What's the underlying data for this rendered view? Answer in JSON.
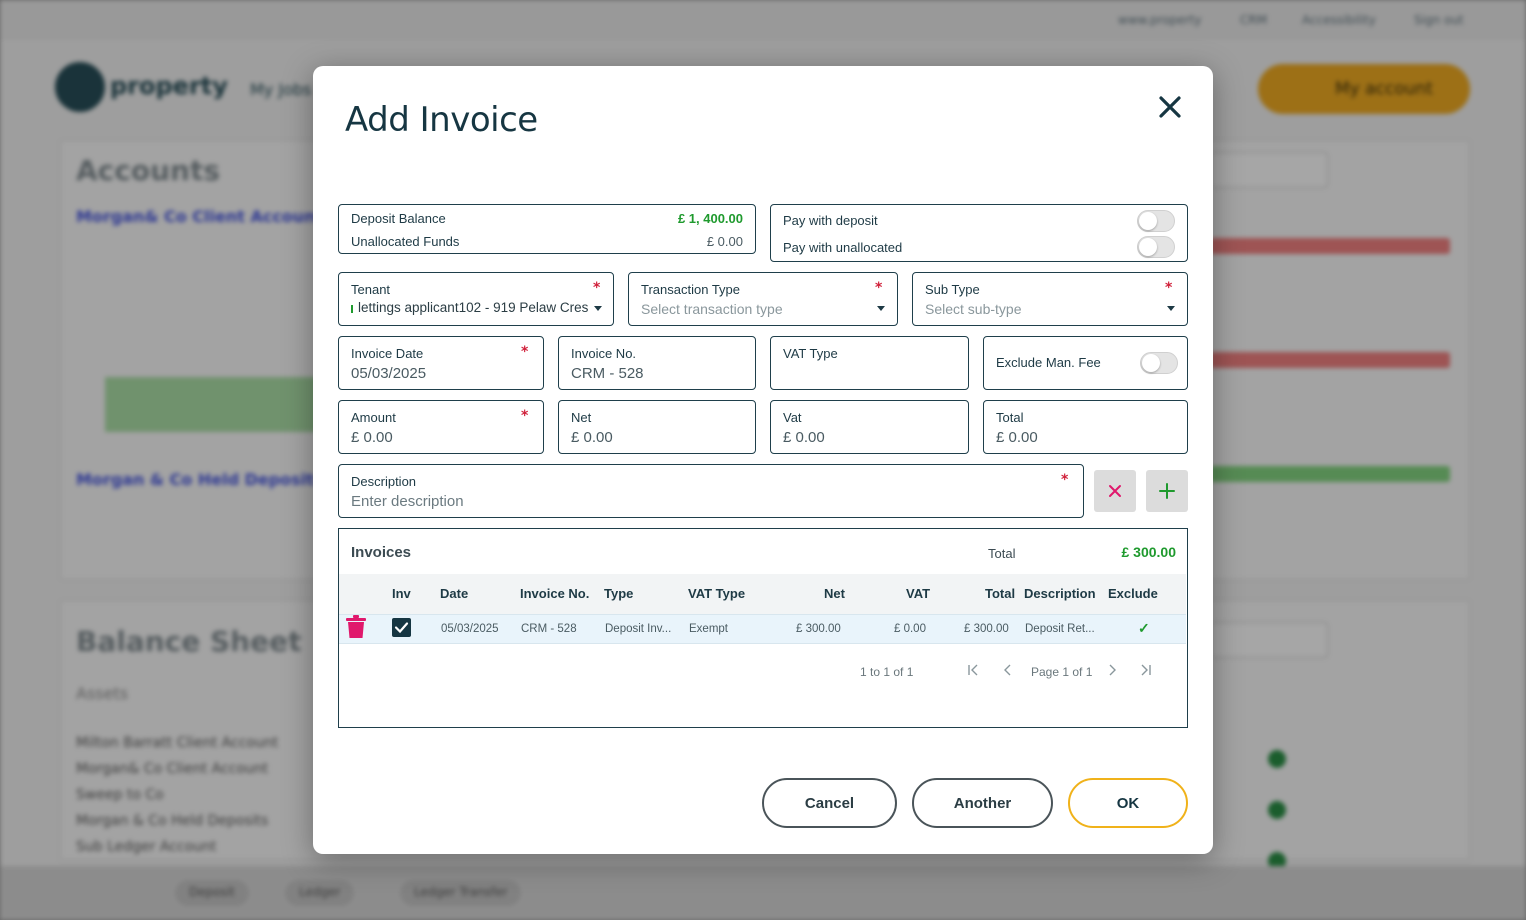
{
  "background": {
    "top_links": [
      "www.property",
      "CRM",
      "Accessibility",
      "Sign out"
    ],
    "logo_text": "property",
    "nav_text": "My Jobs",
    "account_button": "My account",
    "accounts_heading": "Accounts",
    "balance_heading": "Balance Sheet",
    "account_links": [
      "Morgan& Co Client Account",
      "Morgan & Co Held Deposits"
    ],
    "assets_label": "Assets",
    "list_items": [
      "Milton Barratt Client Account",
      "Morgan& Co Client Account",
      "Sweep to Co",
      "Morgan & Co Held Deposits",
      "Sub Ledger Account"
    ],
    "bottom_tabs": [
      "Deposit",
      "Ledger",
      "Ledger Transfer"
    ]
  },
  "modal": {
    "title": "Add Invoice",
    "balance": {
      "deposit_label": "Deposit Balance",
      "deposit_value": "£ 1, 400.00",
      "unallocated_label": "Unallocated Funds",
      "unallocated_value": "£ 0.00"
    },
    "pay": {
      "with_deposit": "Pay with deposit",
      "with_unallocated": "Pay with unallocated"
    },
    "tenant": {
      "label": "Tenant",
      "value": "lettings applicant102 - 919 Pelaw Cres"
    },
    "transaction_type": {
      "label": "Transaction Type",
      "placeholder": "Select transaction type"
    },
    "sub_type": {
      "label": "Sub Type",
      "placeholder": "Select sub-type"
    },
    "invoice_date": {
      "label": "Invoice Date",
      "value": "05/03/2025"
    },
    "invoice_no": {
      "label": "Invoice No.",
      "value": "CRM - 528"
    },
    "vat_type": {
      "label": "VAT Type",
      "value": ""
    },
    "exclude_fee": {
      "label": "Exclude Man. Fee"
    },
    "amount": {
      "label": "Amount",
      "value": "£ 0.00"
    },
    "net": {
      "label": "Net",
      "value": "£ 0.00"
    },
    "vat": {
      "label": "Vat",
      "value": "£ 0.00"
    },
    "total": {
      "label": "Total",
      "value": "£ 0.00"
    },
    "description": {
      "label": "Description",
      "placeholder": "Enter description"
    },
    "required_mark": "*",
    "invoices": {
      "title": "Invoices",
      "total_label": "Total",
      "total_value": "£ 300.00",
      "columns": [
        "Inv",
        "Date",
        "Invoice No.",
        "Type",
        "VAT Type",
        "Net",
        "VAT",
        "Total",
        "Description",
        "Exclude"
      ],
      "rows": [
        {
          "date": "05/03/2025",
          "invoice_no": "CRM - 528",
          "type": "Deposit Inv...",
          "vat_type": "Exempt",
          "net": "£ 300.00",
          "vat": "£ 0.00",
          "total": "£ 300.00",
          "description": "Deposit Ret...",
          "exclude": "✓"
        }
      ],
      "pager_range": "1 to 1 of 1",
      "pager_page": "Page 1 of 1"
    },
    "buttons": {
      "cancel": "Cancel",
      "another": "Another",
      "ok": "OK"
    }
  },
  "colors": {
    "accent_green": "#1f9a2e",
    "danger_pink": "#e0186c",
    "ok_border": "#f0b21a",
    "required_red": "#d0203a"
  }
}
